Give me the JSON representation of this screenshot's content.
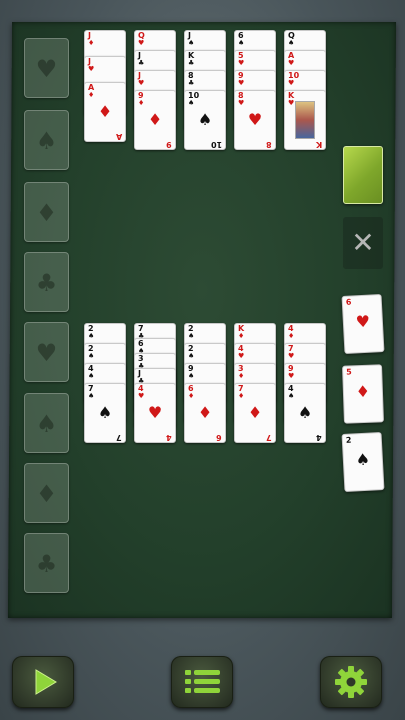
{
  "board": {
    "foundations": [
      {
        "suit": "hearts",
        "symbol": "♥",
        "color": "red"
      },
      {
        "suit": "spades",
        "symbol": "♠",
        "color": "black"
      },
      {
        "suit": "diamonds",
        "symbol": "♦",
        "color": "red"
      },
      {
        "suit": "clubs",
        "symbol": "♣",
        "color": "black"
      },
      {
        "suit": "hearts",
        "symbol": "♥",
        "color": "red"
      },
      {
        "suit": "spades",
        "symbol": "♠",
        "color": "black"
      },
      {
        "suit": "diamonds",
        "symbol": "♦",
        "color": "red"
      },
      {
        "suit": "clubs",
        "symbol": "♣",
        "color": "black"
      }
    ],
    "top_tableau": [
      [
        "J♦",
        "J♥",
        "A♦"
      ],
      [
        "Q♥",
        "J♣",
        "J♥",
        "9♦"
      ],
      [
        "J♠",
        "K♣",
        "8♣",
        "10♠"
      ],
      [
        "6♠",
        "5♥",
        "9♥",
        "8♥"
      ],
      [
        "Q♠",
        "A♥",
        "10♥",
        "K♥"
      ]
    ],
    "bottom_tableau": [
      [
        "2♠",
        "2♠",
        "4♠",
        "7♠"
      ],
      [
        "7♣",
        "6♠",
        "3♣",
        "J♣",
        "4♥"
      ],
      [
        "2♠",
        "2♠",
        "9♠",
        "6♦"
      ],
      [
        "K♦",
        "4♥",
        "3♦",
        "7♦"
      ],
      [
        "4♦",
        "7♥",
        "9♥",
        "4♠"
      ]
    ],
    "reserve": [
      "6♥",
      "5♦",
      "2♠"
    ],
    "discard_icon": "close-icon"
  },
  "toolbar": {
    "play_icon": "play-icon",
    "menu_icon": "menu-icon",
    "settings_icon": "gear-icon",
    "accent": "#8fd43a"
  }
}
